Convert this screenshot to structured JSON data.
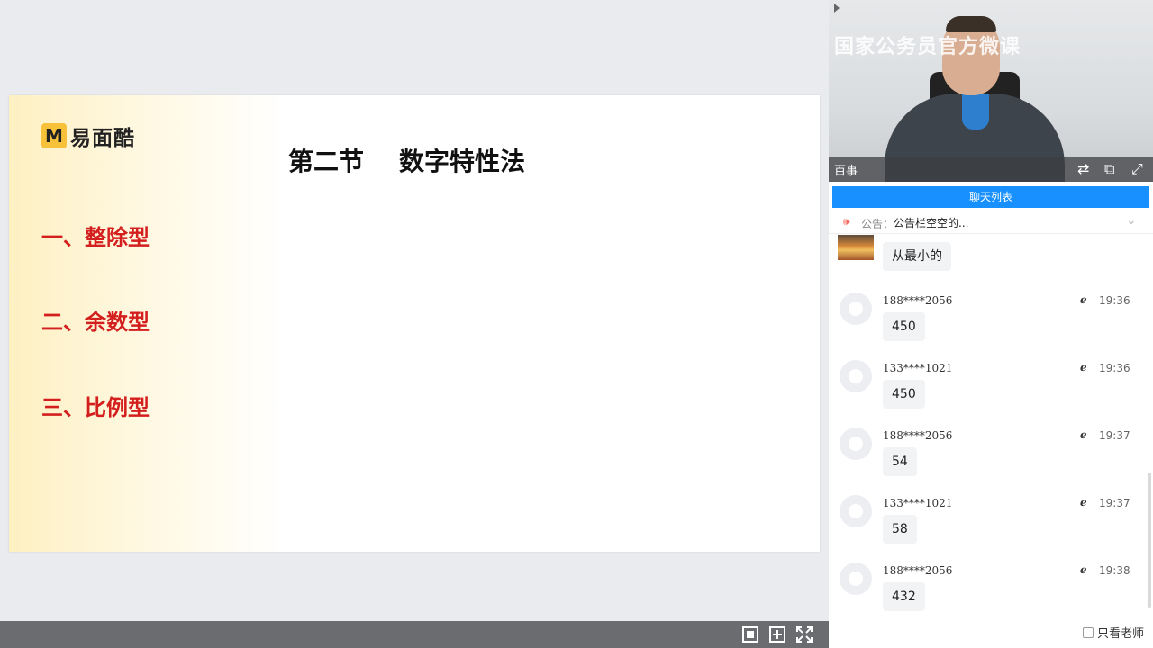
{
  "slide": {
    "logo_mark": "M",
    "logo_text": "易面酷",
    "title": "第二节    数字特性法",
    "points": [
      "一、整除型",
      "二、余数型",
      "三、比例型"
    ]
  },
  "controls": {
    "fit_icon": "fit-screen-icon",
    "pip_icon": "picture-in-picture-icon",
    "fullscreen_icon": "fullscreen-icon"
  },
  "video": {
    "watermark": "国家公务员官方微课",
    "label": "百事",
    "icons": [
      "switch-icon",
      "popout-icon",
      "expand-icon"
    ]
  },
  "chat": {
    "tab_label": "聊天列表",
    "notice_label": "公告：",
    "notice_text": "公告栏空空的...",
    "first_message": "从最小的",
    "messages": [
      {
        "user": "188****2056",
        "time": "19:36",
        "text": "450"
      },
      {
        "user": "133****1021",
        "time": "19:36",
        "text": "450"
      },
      {
        "user": "188****2056",
        "time": "19:37",
        "text": "54"
      },
      {
        "user": "133****1021",
        "time": "19:37",
        "text": "58"
      },
      {
        "user": "188****2056",
        "time": "19:38",
        "text": "432"
      }
    ],
    "only_teacher_label": "只看老师"
  },
  "colors": {
    "accent": "#1890ff",
    "point_red": "#d41f1f",
    "logo_yellow": "#f7c23a"
  }
}
